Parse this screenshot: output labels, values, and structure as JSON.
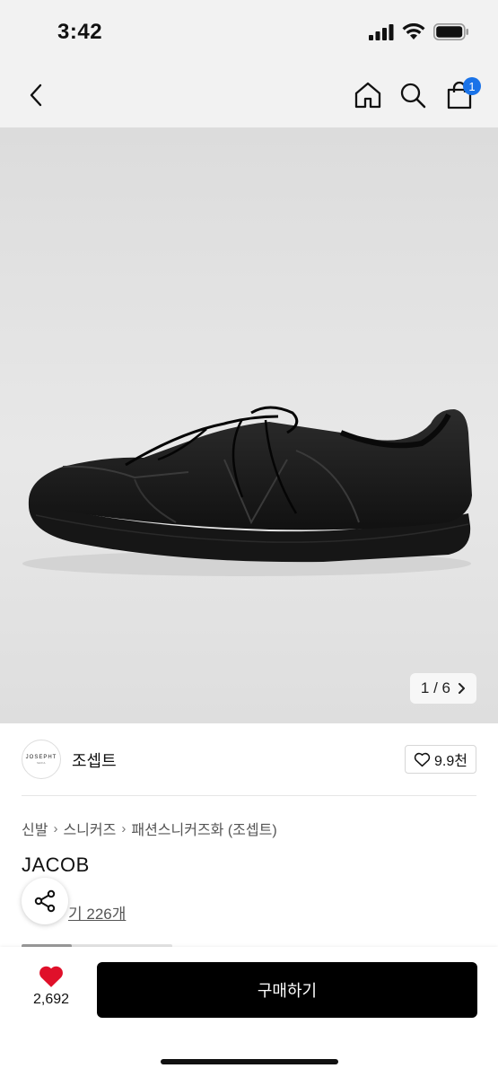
{
  "status": {
    "time": "3:42"
  },
  "header": {
    "back": "back-icon",
    "home": "home-icon",
    "search": "search-icon",
    "cart": "cart-icon",
    "cart_badge": "1",
    "badge_color": "#1a73e8"
  },
  "gallery": {
    "current": "1",
    "total": "6",
    "counter_label": "1 / 6"
  },
  "brand": {
    "logo_text": "JOSEPHT",
    "logo_subtext": "SEOUL",
    "name": "조셉트",
    "likes": "9.9천"
  },
  "breadcrumb": {
    "items": [
      "신발",
      "스니커즈",
      "패션스니커즈화 (조셉트)"
    ]
  },
  "product": {
    "name": "JACOB",
    "reviews": "후기 226개",
    "reviews_visible": "기 226개"
  },
  "bottom": {
    "wish_count": "2,692",
    "buy_label": "구매하기",
    "heart_color": "#e0102a"
  }
}
